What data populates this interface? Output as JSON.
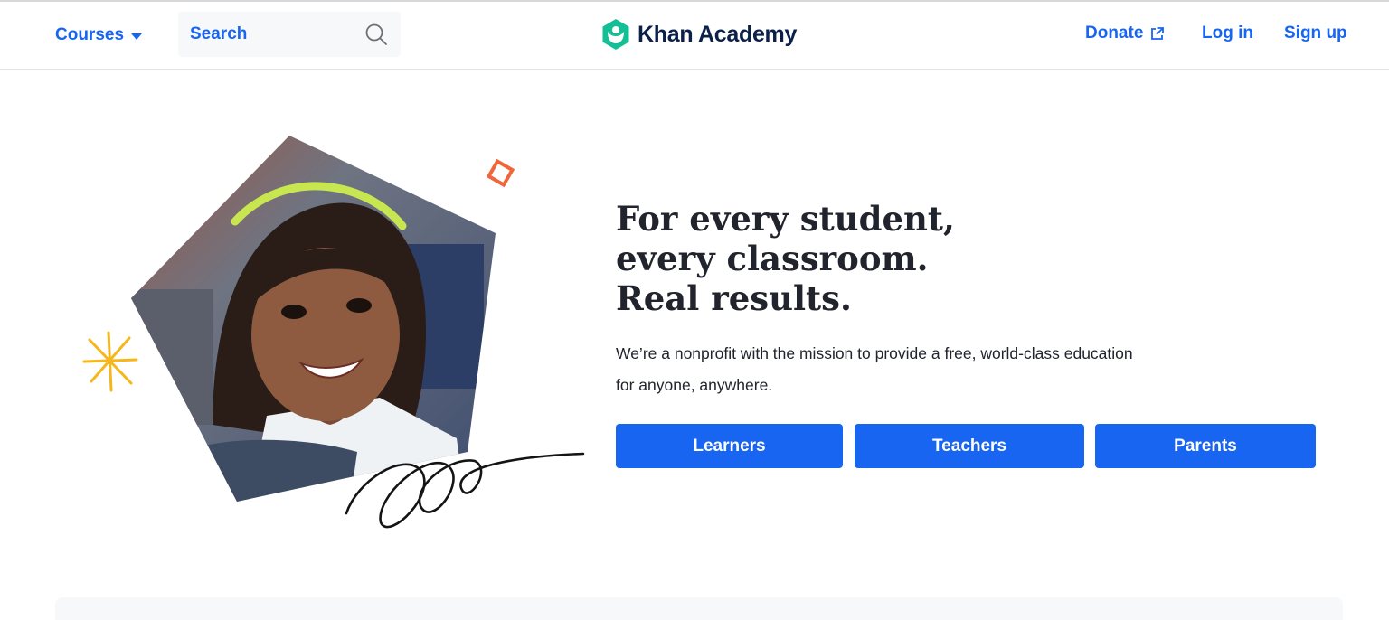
{
  "header": {
    "courses_label": "Courses",
    "search_placeholder": "Search",
    "logo_text": "Khan Academy",
    "donate_label": "Donate",
    "login_label": "Log in",
    "signup_label": "Sign up"
  },
  "hero": {
    "headline_lines": [
      "For every student,",
      "every classroom.",
      "Real results."
    ],
    "subtext_line1": "We’re a nonprofit with the mission to provide a free, world-class education",
    "subtext_line2": "for anyone, anywhere.",
    "buttons": [
      "Learners",
      "Teachers",
      "Parents"
    ]
  },
  "colors": {
    "accent": "#1865f2",
    "logo_green": "#14bf96",
    "text_dark": "#21242c",
    "brand_navy": "#0b2149",
    "star_yellow": "#f5b71b",
    "diamond_orange": "#f0663a"
  },
  "icons": [
    "chevron-down-icon",
    "search-icon",
    "khan-logo-icon",
    "external-link-icon",
    "sparkle-icon",
    "diamond-icon",
    "squiggle-icon"
  ]
}
